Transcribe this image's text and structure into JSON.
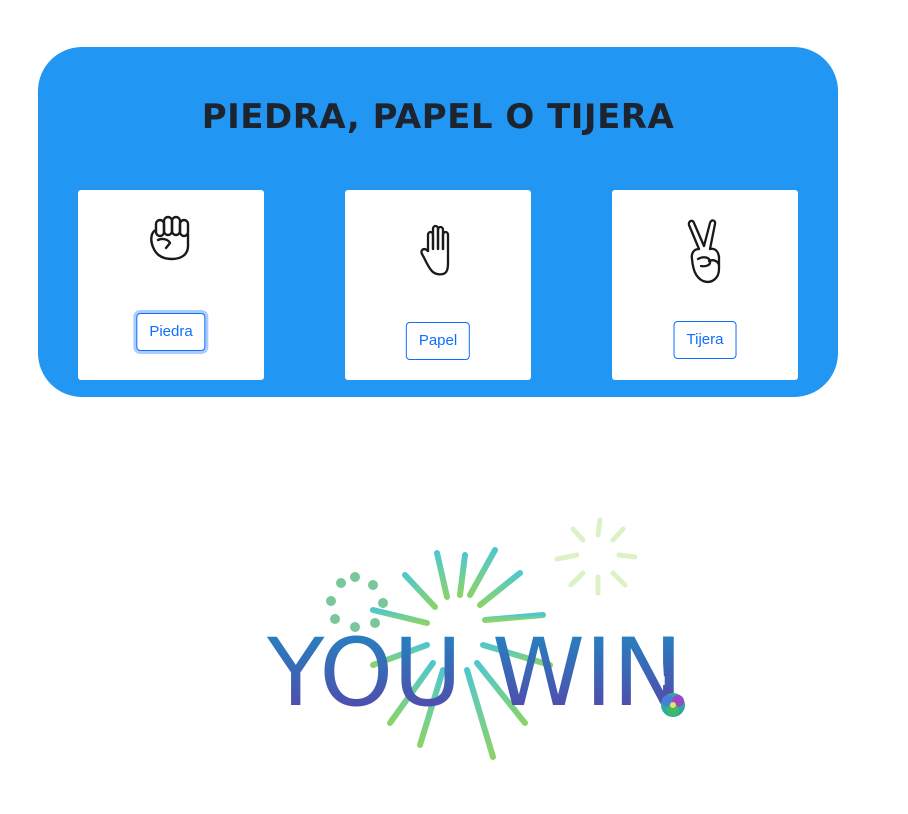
{
  "game": {
    "title": "PIEDRA, PAPEL O TIJERA",
    "options": [
      {
        "label": "Piedra",
        "icon": "fist-icon"
      },
      {
        "label": "Papel",
        "icon": "open-hand-icon"
      },
      {
        "label": "Tijera",
        "icon": "peace-hand-icon"
      }
    ]
  },
  "result": {
    "text": "YOU WIN",
    "mark": "!"
  },
  "colors": {
    "panel": "#2196f3",
    "button": "#0d6efd",
    "title": "#1d2430"
  }
}
